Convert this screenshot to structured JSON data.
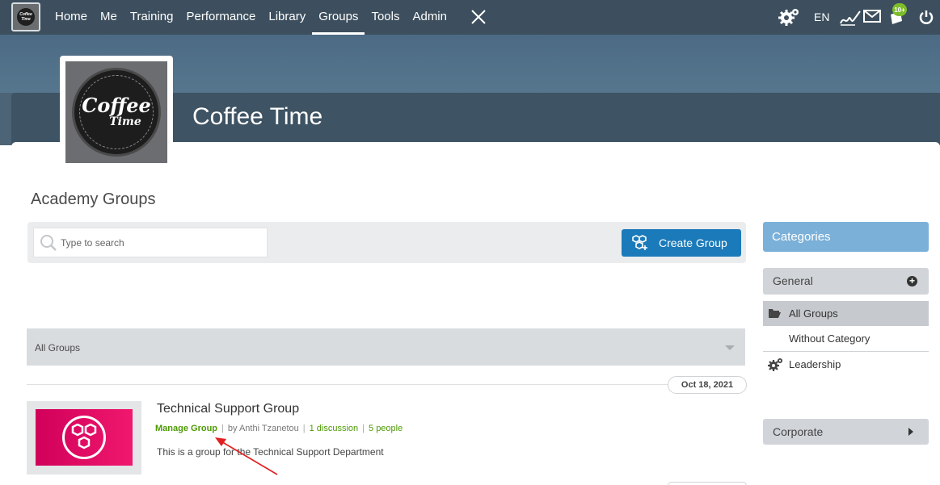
{
  "nav": {
    "items": [
      {
        "label": "Home"
      },
      {
        "label": "Me"
      },
      {
        "label": "Training"
      },
      {
        "label": "Performance"
      },
      {
        "label": "Library"
      },
      {
        "label": "Groups",
        "active": true
      },
      {
        "label": "Tools"
      },
      {
        "label": "Admin"
      }
    ],
    "logo_text": "Coffee Time",
    "lang": "EN",
    "notification_badge": "10+",
    "icons": [
      "settings-gears-icon",
      "signature-icon",
      "mail-icon",
      "notifications-icon",
      "power-icon"
    ]
  },
  "group": {
    "title": "Coffee Time",
    "logo_word1": "Coffee",
    "logo_word2": "Time"
  },
  "page": {
    "heading": "Academy Groups",
    "search_placeholder": "Type to search",
    "create_button": "Create Group",
    "filter_label": "All Groups"
  },
  "groups": [
    {
      "date": "Oct 18, 2021",
      "name": "Technical Support Group",
      "manage_label": "Manage Group",
      "owner": "by Anthi Tzanetou",
      "discussions": "1 discussion",
      "people": "5 people",
      "description": "This is a group for the Technical Support Department"
    }
  ],
  "sidebar": {
    "heading": "Categories",
    "general": "General",
    "all_groups": "All Groups",
    "without_category": "Without Category",
    "leadership": "Leadership",
    "corporate": "Corporate"
  },
  "colors": {
    "nav_bg": "#3d4f5e",
    "accent_blue": "#1b7ab9",
    "category_header": "#7bb0d8",
    "link_green": "#4e9a06",
    "group_thumb_pink": "#e0116a"
  }
}
